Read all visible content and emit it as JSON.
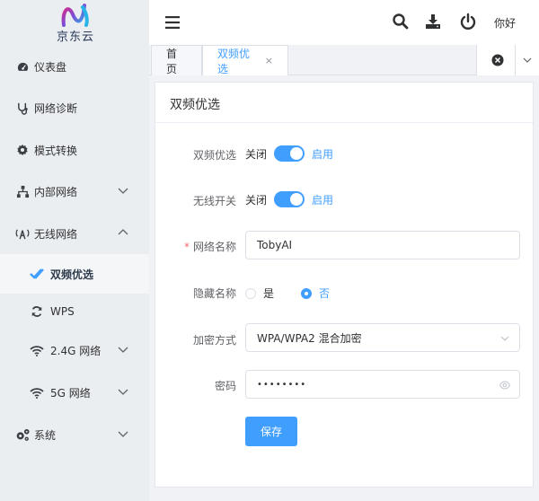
{
  "brand": {
    "logo_text": "京东云"
  },
  "sidebar": {
    "items": [
      {
        "label": "仪表盘",
        "icon": "dashboard-icon"
      },
      {
        "label": "网络诊断",
        "icon": "stethoscope-icon"
      },
      {
        "label": "模式转换",
        "icon": "cog-icon"
      },
      {
        "label": "内部网络",
        "icon": "network-icon",
        "expandable": true
      },
      {
        "label": "无线网络",
        "icon": "antenna-icon",
        "expanded": true
      },
      {
        "label": "双频优选",
        "icon": "double-check-icon",
        "active": true
      },
      {
        "label": "WPS",
        "icon": "refresh-icon"
      },
      {
        "label": "2.4G 网络",
        "icon": "wifi-icon",
        "expandable": true
      },
      {
        "label": "5G 网络",
        "icon": "wifi-icon",
        "expandable": true
      },
      {
        "label": "系统",
        "icon": "cogs-icon",
        "expandable": true
      }
    ]
  },
  "header": {
    "greeting": "你好"
  },
  "tabs": [
    {
      "label": "首页"
    },
    {
      "label": "双频优选",
      "active": true,
      "close": "×"
    }
  ],
  "card": {
    "title": "双频优选",
    "form": {
      "dual_band": {
        "label": "双频优选",
        "off": "关闭",
        "on": "启用",
        "value": true
      },
      "wireless": {
        "label": "无线开关",
        "off": "关闭",
        "on": "启用",
        "value": true
      },
      "ssid": {
        "label": "网络名称",
        "required_mark": "*",
        "value": "TobyAI"
      },
      "hide_name": {
        "label": "隐藏名称",
        "options": [
          "是",
          "否"
        ],
        "selected": "否"
      },
      "encryption": {
        "label": "加密方式",
        "value": "WPA/WPA2 混合加密"
      },
      "password": {
        "label": "密码",
        "value": "••••••••"
      },
      "save_label": "保存"
    }
  },
  "colors": {
    "primary": "#409eff",
    "sidebar_bg": "#ebeef1",
    "danger": "#f56c6c"
  }
}
